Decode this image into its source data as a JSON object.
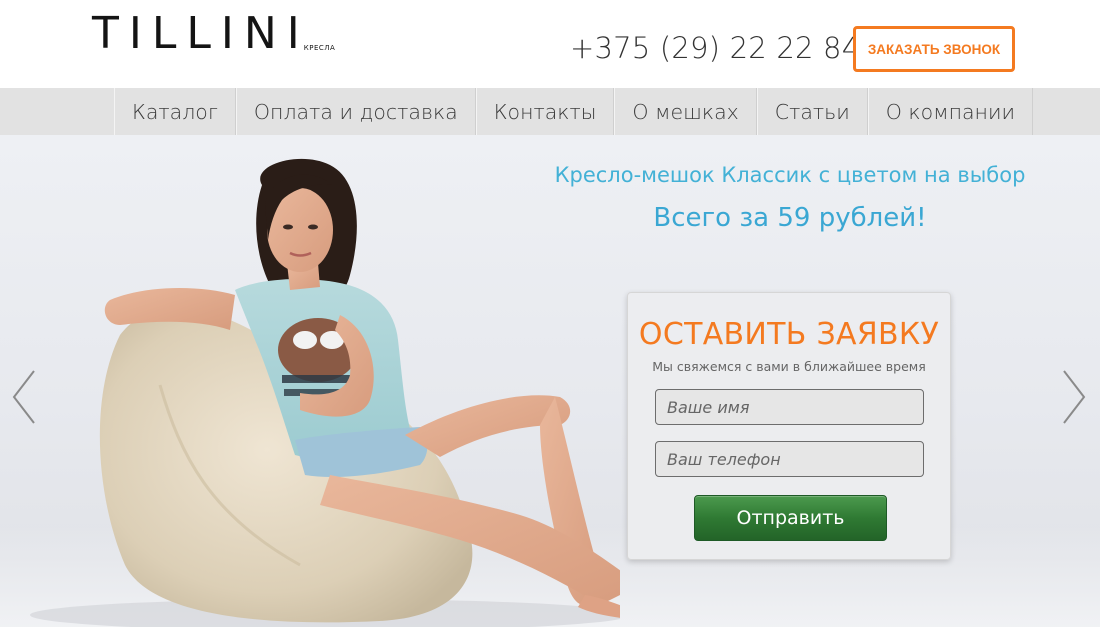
{
  "header": {
    "logo_text": "TILLINI",
    "logo_sub": "КРЕСЛА",
    "phone": "+375 (29) 22 22 843",
    "call_button": "ЗАКАЗАТЬ ЗВОНОК"
  },
  "nav": {
    "items": [
      {
        "label": "Каталог"
      },
      {
        "label": "Оплата и доставка"
      },
      {
        "label": "Контакты"
      },
      {
        "label": "О мешках"
      },
      {
        "label": "Статьи"
      },
      {
        "label": "О компании"
      }
    ]
  },
  "hero": {
    "promo_line1": "Кресло-мешок Классик с цветом на выбор",
    "promo_line2": "Всего за 59 рублей!",
    "prev_icon": "chevron-left-icon",
    "next_icon": "chevron-right-icon"
  },
  "form": {
    "title": "ОСТАВИТЬ ЗАЯВКУ",
    "subtitle": "Мы свяжемся с вами в ближайшее время",
    "name_placeholder": "Ваше имя",
    "phone_placeholder": "Ваш телефон",
    "submit_label": "Отправить"
  },
  "colors": {
    "accent_orange": "#f47a20",
    "promo_blue": "#43b1d6",
    "submit_green": "#2f7a33",
    "nav_bg": "#e2e2e2"
  }
}
